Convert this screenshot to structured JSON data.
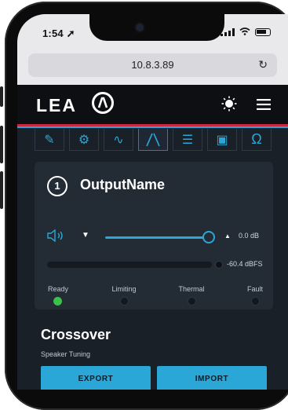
{
  "status_bar": {
    "time": "1:54"
  },
  "browser": {
    "url": "10.8.3.89"
  },
  "app": {
    "logo_text": "LEA",
    "tabs": [
      {
        "icon": "brush-icon"
      },
      {
        "icon": "gear-icon"
      },
      {
        "icon": "wave-icon"
      },
      {
        "icon": "crossover-icon",
        "active": true
      },
      {
        "icon": "sliders-icon"
      },
      {
        "icon": "speaker-box-icon"
      },
      {
        "icon": "omega-icon"
      }
    ]
  },
  "output": {
    "number": "1",
    "name": "OutputName",
    "gain": "0.0 dB",
    "meter_value": "-60.4 dBFS",
    "indicators": [
      {
        "label": "Ready",
        "on": true
      },
      {
        "label": "Limiting",
        "on": false
      },
      {
        "label": "Thermal",
        "on": false
      },
      {
        "label": "Fault",
        "on": false
      }
    ]
  },
  "crossover": {
    "title": "Crossover",
    "subtitle": "Speaker Tuning",
    "export_label": "EXPORT",
    "import_label": "IMPORT"
  },
  "colors": {
    "accent": "#2aa7d6",
    "brand_red": "#c9283d",
    "ready_green": "#3cc04a"
  }
}
